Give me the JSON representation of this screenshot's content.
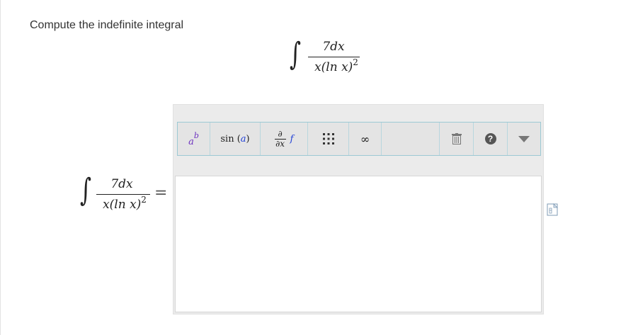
{
  "question": {
    "prompt": "Compute the indefinite integral"
  },
  "integral": {
    "sign": "∫",
    "numerator": "7dx",
    "denominator_base": "x(ln x)",
    "denominator_exp": "2"
  },
  "equals": "=",
  "toolbar": {
    "superscript_base": "a",
    "superscript_exp": "b",
    "function_label": "sin",
    "function_arg": "a",
    "partial_top": "∂",
    "partial_bottom": "∂x",
    "partial_f": "f",
    "matrix_icon": "matrix-icon",
    "infinity": "∞",
    "blank": "",
    "delete_icon": "trash-icon",
    "help": "?",
    "dropdown_icon": "caret-down-icon"
  },
  "answer": {
    "value": ""
  },
  "colors": {
    "toolbar_border": "#9cc9d4",
    "editor_bg": "#ebebeb",
    "var_a": "#6b2fbf",
    "var_b": "#6b2fbf",
    "link_blue": "#1f3fd6",
    "help_bg": "#555555"
  }
}
